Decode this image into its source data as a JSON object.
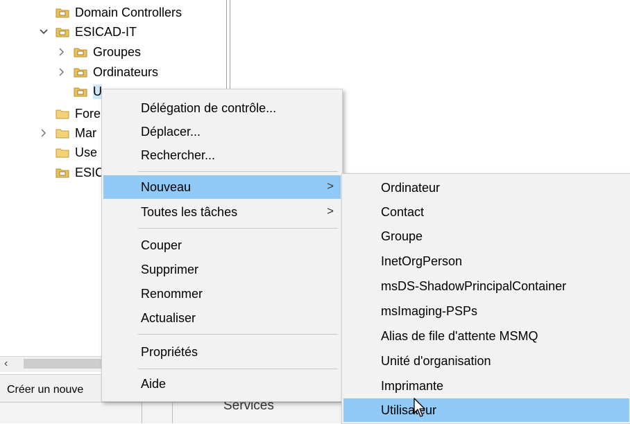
{
  "tree": {
    "items": [
      {
        "label": "Domain Controllers",
        "expander": "",
        "icon": "ou-folder-icon"
      },
      {
        "label": "ESICAD-IT",
        "expander": "expanded",
        "icon": "ou-folder-icon"
      },
      {
        "label": "Groupes",
        "expander": "collapsed",
        "icon": "ou-folder-icon"
      },
      {
        "label": "Ordinateurs",
        "expander": "collapsed",
        "icon": "ou-folder-icon"
      },
      {
        "label": "U",
        "expander": "",
        "icon": "ou-folder-icon",
        "selected": true
      },
      {
        "label": "Fore",
        "expander": "",
        "icon": "container-folder-icon"
      },
      {
        "label": "Mar",
        "expander": "collapsed",
        "icon": "container-folder-icon"
      },
      {
        "label": "Use",
        "expander": "",
        "icon": "container-folder-icon"
      },
      {
        "label": "ESIC",
        "expander": "",
        "icon": "ou-folder-icon"
      }
    ]
  },
  "status": {
    "text": "Créer un nouve"
  },
  "bottom": {
    "services_label": "Services"
  },
  "context_menu": {
    "items": [
      {
        "label": "Délégation de contrôle..."
      },
      {
        "label": "Déplacer..."
      },
      {
        "label": "Rechercher..."
      },
      {
        "label": "Nouveau",
        "has_submenu": true,
        "highlighted": true
      },
      {
        "label": "Toutes les tâches",
        "has_submenu": true
      },
      {
        "label": "Couper"
      },
      {
        "label": "Supprimer"
      },
      {
        "label": "Renommer"
      },
      {
        "label": "Actualiser"
      },
      {
        "label": "Propriétés"
      },
      {
        "label": "Aide"
      }
    ],
    "submenu_arrow": ">"
  },
  "submenu": {
    "items": [
      {
        "label": "Ordinateur"
      },
      {
        "label": "Contact"
      },
      {
        "label": "Groupe"
      },
      {
        "label": "InetOrgPerson"
      },
      {
        "label": "msDS-ShadowPrincipalContainer"
      },
      {
        "label": "msImaging-PSPs"
      },
      {
        "label": "Alias de file d'attente MSMQ"
      },
      {
        "label": "Unité d'organisation"
      },
      {
        "label": "Imprimante"
      },
      {
        "label": "Utilisateur",
        "highlighted": true
      }
    ]
  },
  "colors": {
    "menu_bg": "#f2f2f2",
    "highlight": "#91c9f7",
    "selection": "#cce8ff",
    "folder": "#e8c15c"
  }
}
